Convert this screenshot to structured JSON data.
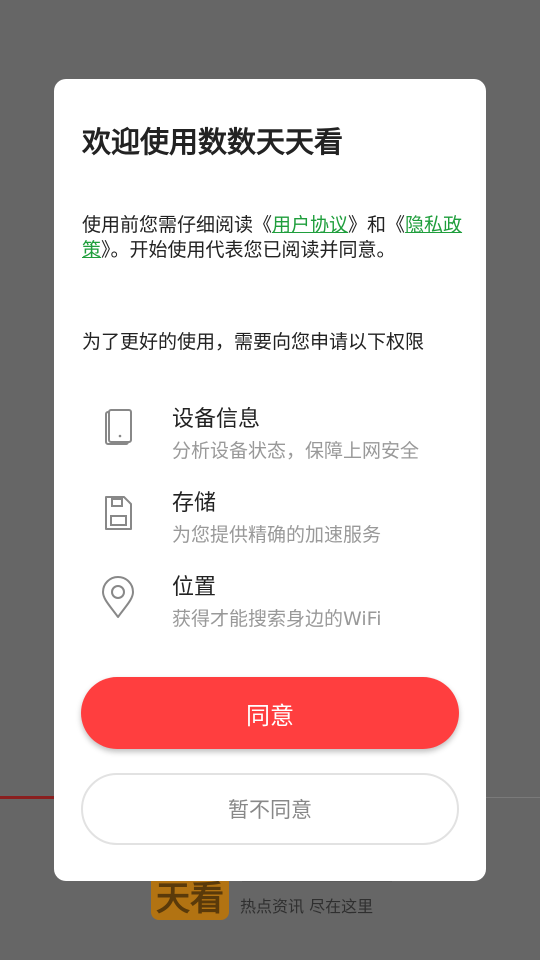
{
  "background": {
    "logo_char": "天看",
    "slogan": "热点资讯 尽在这里"
  },
  "dialog": {
    "title": "欢迎使用数数天天看",
    "agreement": {
      "prefix": "使用前您需仔细阅读《",
      "user_agreement_link": "用户协议",
      "middle": "》和《",
      "privacy_link": "隐私政策",
      "suffix": "》。开始使用代表您已阅读并同意。"
    },
    "permission_intro": "为了更好的使用，需要向您申请以下权限",
    "permissions": [
      {
        "icon": "device-icon",
        "title": "设备信息",
        "desc": "分析设备状态，保障上网安全"
      },
      {
        "icon": "storage-icon",
        "title": "存储",
        "desc": "为您提供精确的加速服务"
      },
      {
        "icon": "location-icon",
        "title": "位置",
        "desc": "获得才能搜索身边的WiFi"
      }
    ],
    "agree_button": "同意",
    "disagree_button": "暂不同意"
  },
  "colors": {
    "accent": "#ff3e3f",
    "link": "#1f9e3c",
    "overlay": "#666666"
  }
}
